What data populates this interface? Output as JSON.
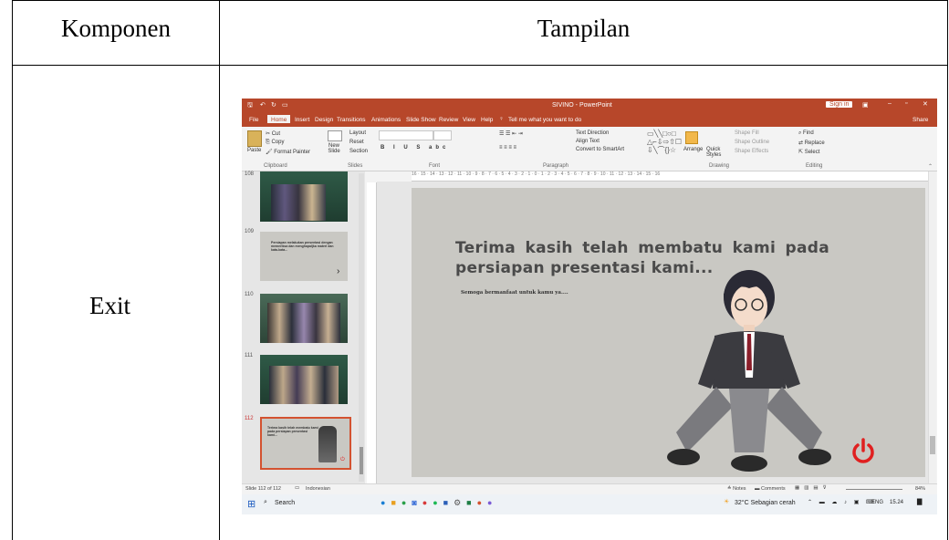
{
  "table": {
    "header_left": "Komponen",
    "header_right": "Tampilan",
    "row_label": "Exit"
  },
  "app": {
    "window_title": "SIVINO - PowerPoint",
    "sign_in": "Sign in",
    "share": "Share",
    "tabs": [
      "File",
      "Home",
      "Insert",
      "Design",
      "Transitions",
      "Animations",
      "Slide Show",
      "Review",
      "View",
      "Help",
      "Tell me what you want to do"
    ],
    "active_tab": "Home",
    "ribbon_groups": [
      "Clipboard",
      "Slides",
      "Font",
      "Paragraph",
      "Drawing",
      "Editing"
    ],
    "clipboard": {
      "paste": "Paste",
      "cut": "Cut",
      "copy": "Copy",
      "format_painter": "Format Painter"
    },
    "slides_group": {
      "new_slide": "New Slide",
      "layout": "Layout",
      "reset": "Reset",
      "section": "Section"
    },
    "paragraph": {
      "text_direction": "Text Direction",
      "align_text": "Align Text",
      "smartart": "Convert to SmartArt"
    },
    "drawing": {
      "arrange": "Arrange",
      "quick_styles": "Quick Styles",
      "shape_fill": "Shape Fill",
      "shape_outline": "Shape Outline",
      "shape_effects": "Shape Effects"
    },
    "editing": {
      "find": "Find",
      "replace": "Replace",
      "select": "Select"
    },
    "ruler_text": "16 · 15 · 14 · 13 · 12 · 11 · 10 · 9 · 8 · 7 · 6 · 5 · 4 · 3 · 2 · 1 · 0 · 1 · 2 · 3 · 4 · 5 · 6 · 7 · 8 · 9 · 10 · 11 · 12 · 13 · 14 · 15 · 16",
    "thumbnails": [
      {
        "num": "108"
      },
      {
        "num": "109",
        "text": "Persiapan melakukan presentasi dengan memeriksa dan menghapaljka materi dan kata-kata..."
      },
      {
        "num": "110"
      },
      {
        "num": "111"
      },
      {
        "num": "112",
        "text": "Terima kasih telah membatu kami pada persiapan presentasi kami..."
      }
    ],
    "slide": {
      "heading": "Terima kasih telah membatu kami pada persiapan presentasi kami...",
      "subtext": "Semoga bermanfaat untuk kamu ya....",
      "power_color": "#e02020"
    },
    "status": {
      "slide_count": "Slide 112 of 112",
      "language": "Indonesian",
      "notes": "Notes",
      "comments": "Comments",
      "zoom": "84%"
    },
    "taskbar": {
      "search": "Search",
      "weather": "32°C Sebagian cerah",
      "lang": "ENG",
      "time": "15.24"
    },
    "accent": "#b7472a"
  }
}
